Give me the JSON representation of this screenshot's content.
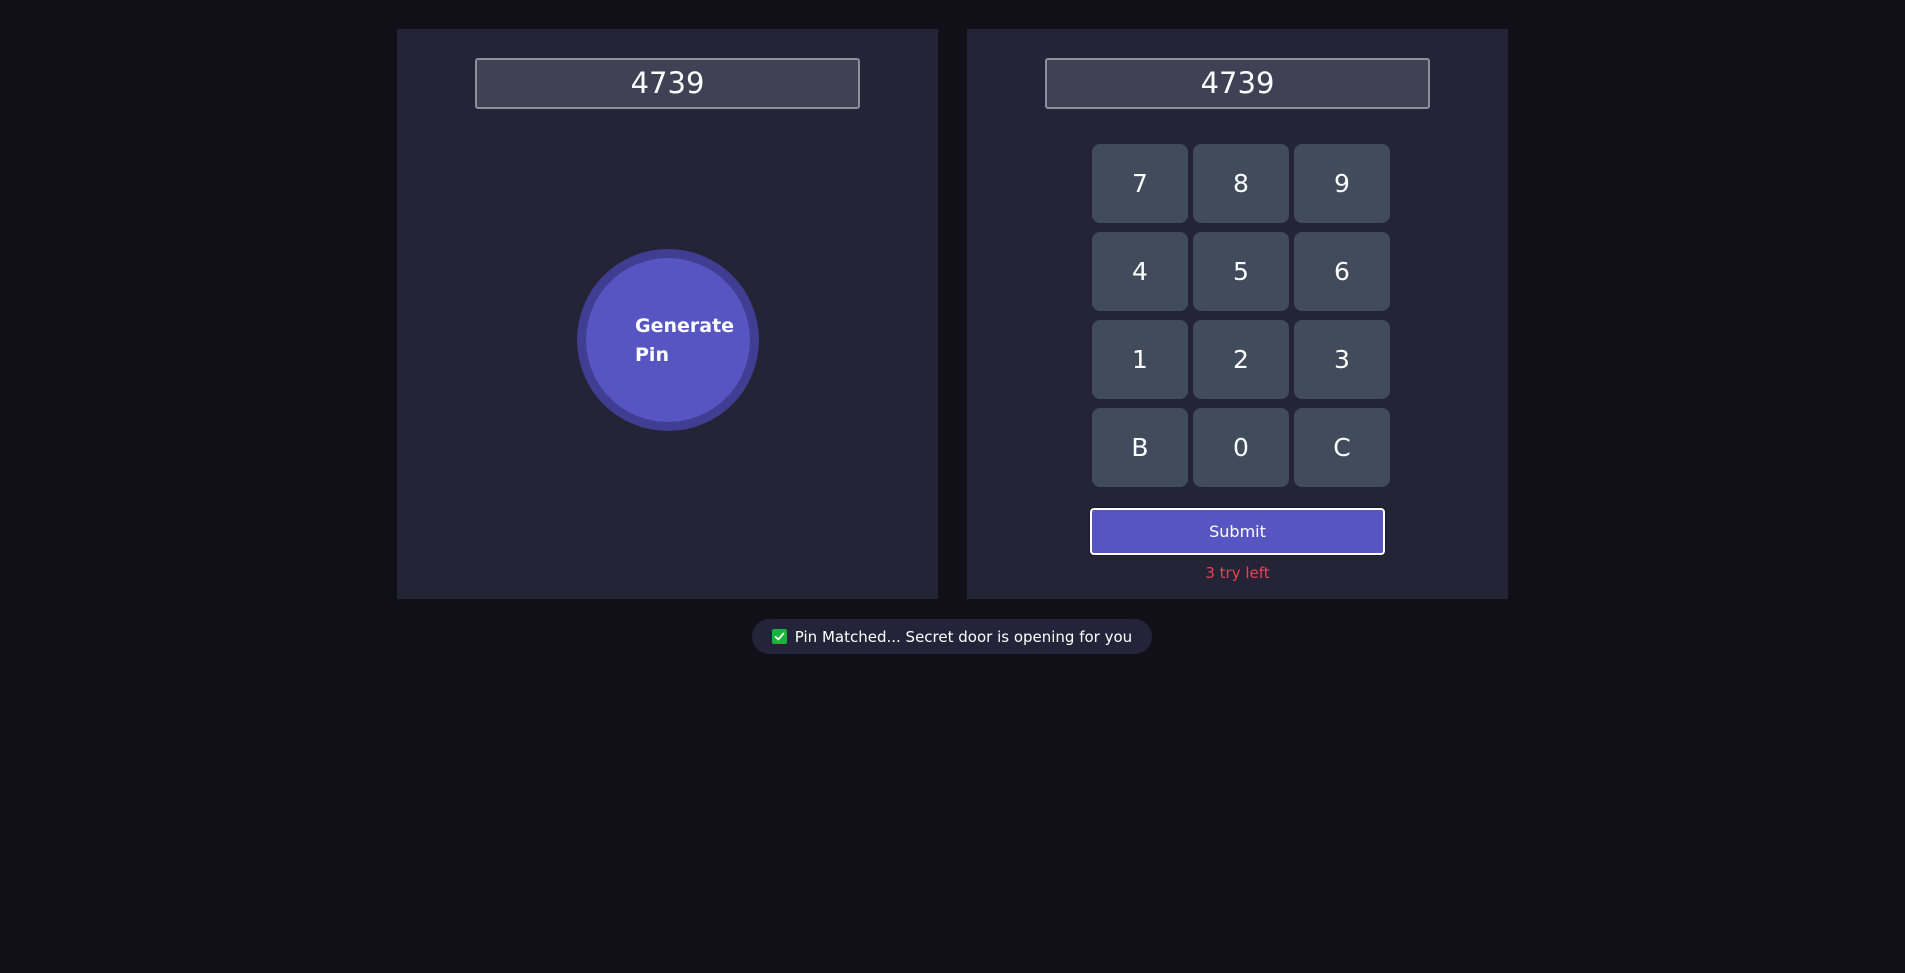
{
  "generator": {
    "pin_value": "4739",
    "button_label_line1": "Generate",
    "button_label_line2": "Pin"
  },
  "keypad": {
    "display_value": "4739",
    "keys": [
      "7",
      "8",
      "9",
      "4",
      "5",
      "6",
      "1",
      "2",
      "3",
      "B",
      "0",
      "C"
    ],
    "submit_label": "Submit",
    "tries_text": "3 try left"
  },
  "notification": {
    "icon": "check-icon",
    "message": "Pin Matched... Secret door is opening for you"
  },
  "colors": {
    "background": "#111019",
    "panel": "#252436",
    "accent": "#5655c1",
    "key": "#404b5c",
    "error": "#ee3f55",
    "success": "#17b33a"
  }
}
